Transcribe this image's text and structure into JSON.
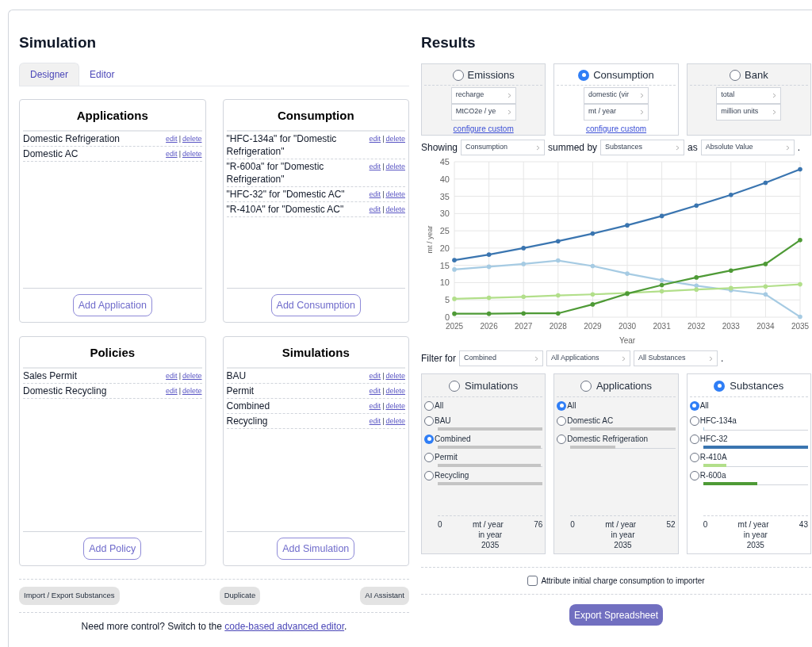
{
  "designer": {
    "title": "Simulation",
    "tabs": [
      {
        "label": "Designer",
        "selected": true
      },
      {
        "label": "Editor",
        "selected": false
      }
    ],
    "cards": [
      {
        "title": "Applications",
        "items": [
          {
            "label": "Domestic Refrigeration",
            "edit": "edit",
            "sep": "|",
            "delete": "delete"
          },
          {
            "label": "Domestic AC",
            "edit": "edit",
            "sep": "|",
            "delete": "delete"
          }
        ],
        "button": "Add Application"
      },
      {
        "title": "Consumption",
        "items": [
          {
            "label": "\"HFC-134a\" for \"Domestic Refrigeration\"",
            "edit": "edit",
            "sep": "|",
            "delete": "delete"
          },
          {
            "label": "\"R-600a\" for \"Domestic Refrigeration\"",
            "edit": "edit",
            "sep": "|",
            "delete": "delete"
          },
          {
            "label": "\"HFC-32\" for \"Domestic AC\"",
            "edit": "edit",
            "sep": "|",
            "delete": "delete"
          },
          {
            "label": "\"R-410A\" for \"Domestic AC\"",
            "edit": "edit",
            "sep": "|",
            "delete": "delete"
          }
        ],
        "button": "Add Consumption"
      },
      {
        "title": "Policies",
        "items": [
          {
            "label": "Sales Permit",
            "edit": "edit",
            "sep": "|",
            "delete": "delete"
          },
          {
            "label": "Domestic Recycling",
            "edit": "edit",
            "sep": "|",
            "delete": "delete"
          }
        ],
        "button": "Add Policy"
      },
      {
        "title": "Simulations",
        "items": [
          {
            "label": "BAU",
            "edit": "edit",
            "sep": "|",
            "delete": "delete"
          },
          {
            "label": "Permit",
            "edit": "edit",
            "sep": "|",
            "delete": "delete"
          },
          {
            "label": "Combined",
            "edit": "edit",
            "sep": "|",
            "delete": "delete"
          },
          {
            "label": "Recycling",
            "edit": "edit",
            "sep": "|",
            "delete": "delete"
          }
        ],
        "button": "Add Simulation"
      }
    ],
    "actions": [
      "Import / Export Substances",
      "Duplicate",
      "AI Assistant"
    ],
    "note": {
      "text": "Need more control? Switch to the ",
      "link": "code-based advanced editor",
      "end": "."
    }
  },
  "results": {
    "title": "Results",
    "metrics": [
      {
        "title": "Emissions",
        "selected": false,
        "selects": [
          "recharge",
          "MtCO2e / ye"
        ],
        "link": "configure custom"
      },
      {
        "title": "Consumption",
        "selected": true,
        "selects": [
          "domestic (vir",
          "mt / year"
        ],
        "link": "configure custom"
      },
      {
        "title": "Bank",
        "selected": false,
        "selects": [
          "total",
          "million units"
        ]
      }
    ],
    "showing": {
      "label": "Showing",
      "value": "Consumption",
      "summed_label": "summed by",
      "summed_value": "Substances",
      "as_label": "as",
      "as_value": "Absolute Value",
      "end": "."
    },
    "chart_data": {
      "type": "line",
      "xlabel": "Year",
      "ylabel": "mt / year",
      "x": [
        2025,
        2026,
        2027,
        2028,
        2029,
        2030,
        2031,
        2032,
        2033,
        2034,
        2035
      ],
      "xlim": [
        2025,
        2035
      ],
      "ylim": [
        0,
        45
      ],
      "grid": true,
      "xticks": [
        2025,
        2026,
        2027,
        2028,
        2029,
        2030,
        2031,
        2032,
        2033,
        2034,
        2035
      ],
      "yticks": [
        0,
        5,
        10,
        15,
        20,
        25,
        30,
        35,
        40,
        45
      ],
      "series": [
        {
          "color": "#3a75b0",
          "values": [
            16.5,
            18.1,
            20,
            22,
            24.2,
            26.6,
            29.3,
            32.3,
            35.4,
            38.9,
            42.8
          ]
        },
        {
          "color": "#a6cbe3",
          "values": [
            13.8,
            14.6,
            15.4,
            16.4,
            14.8,
            12.6,
            10.7,
            9.1,
            7.8,
            6.6,
            0.1
          ]
        },
        {
          "color": "#b2df8a",
          "values": [
            5.3,
            5.6,
            5.9,
            6.3,
            6.6,
            7,
            7.5,
            8,
            8.4,
            8.9,
            9.5
          ]
        },
        {
          "color": "#4e9a36",
          "values": [
            1,
            1,
            1.1,
            1.1,
            3.7,
            6.8,
            9.3,
            11.5,
            13.5,
            15.4,
            22.3
          ]
        }
      ]
    },
    "filter": {
      "label": "Filter for",
      "values": [
        "Combined",
        "All Applications",
        "All Substances"
      ],
      "end": "."
    },
    "filters": [
      {
        "title": "Simulations",
        "selected": false,
        "items": [
          {
            "label": "All",
            "selected": false
          },
          {
            "label": "BAU",
            "selected": false,
            "level": 1
          },
          {
            "label": "Combined",
            "selected": true,
            "level": 0.98
          },
          {
            "label": "Permit",
            "selected": false,
            "level": 0.98
          },
          {
            "label": "Recycling",
            "selected": false,
            "level": 1
          }
        ],
        "scale": {
          "min": "0",
          "unit": "mt / year",
          "max": "76",
          "caption": "in year",
          "year": "2035"
        }
      },
      {
        "title": "Applications",
        "selected": false,
        "items": [
          {
            "label": "All",
            "selected": true
          },
          {
            "label": "Domestic AC",
            "selected": false,
            "level": 1
          },
          {
            "label": "Domestic Refrigeration",
            "selected": false,
            "level": 0.43
          }
        ],
        "scale": {
          "min": "0",
          "unit": "mt / year",
          "max": "52",
          "caption": "in year",
          "year": "2035"
        }
      },
      {
        "title": "Substances",
        "selected": true,
        "items": [
          {
            "label": "All",
            "selected": true
          },
          {
            "label": "HFC-134a",
            "selected": false,
            "level": 0.01,
            "color": "#a6cbe3"
          },
          {
            "label": "HFC-32",
            "selected": false,
            "level": 1,
            "color": "#3a75b0"
          },
          {
            "label": "R-410A",
            "selected": false,
            "level": 0.22,
            "color": "#b2df8a"
          },
          {
            "label": "R-600a",
            "selected": false,
            "level": 0.52,
            "color": "#4e9a36"
          }
        ],
        "scale": {
          "min": "0",
          "unit": "mt / year",
          "max": "43",
          "caption": "in year",
          "year": "2035"
        }
      }
    ],
    "checkbox": {
      "label": "Attribute initial charge consumption to importer",
      "checked": false
    },
    "export_button": "Export Spreadsheet"
  }
}
